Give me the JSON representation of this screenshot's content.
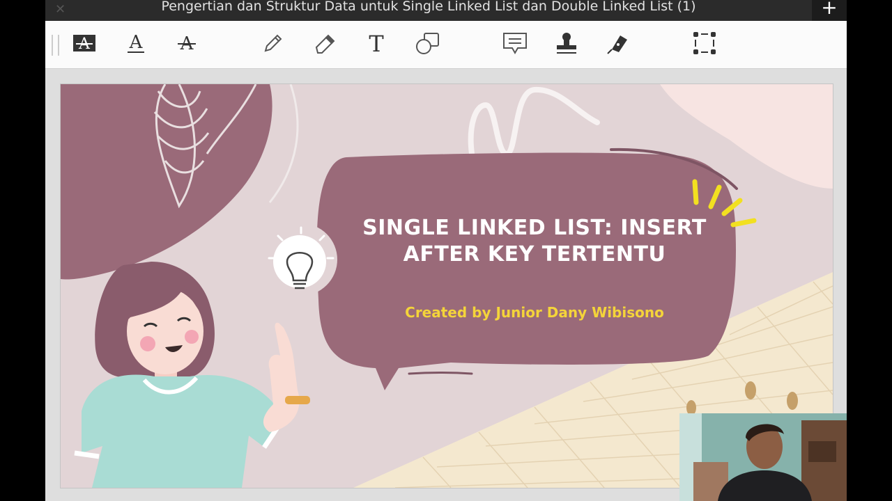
{
  "window": {
    "title": "Pengertian dan Struktur Data untuk Single Linked List dan Double Linked List (1)",
    "new_tab_label": "+"
  },
  "toolbar": {
    "tools": [
      "highlight-text-icon",
      "underline-text-icon",
      "strikethrough-text-icon",
      "pencil-icon",
      "eraser-icon",
      "text-tool-icon",
      "shapes-icon",
      "comment-icon",
      "stamp-icon",
      "signature-pen-icon",
      "selection-icon"
    ]
  },
  "slide": {
    "title_line1": "Single Linked List: Insert",
    "title_line2": "After Key Tertentu",
    "subtitle": "Created by Junior Dany Wibisono",
    "colors": {
      "background": "#e2d4d6",
      "bubble": "#9a6a79",
      "subtitle": "#f4d43a",
      "grid_paper": "#f4e8cf",
      "accent_yellow": "#f2e020"
    }
  }
}
